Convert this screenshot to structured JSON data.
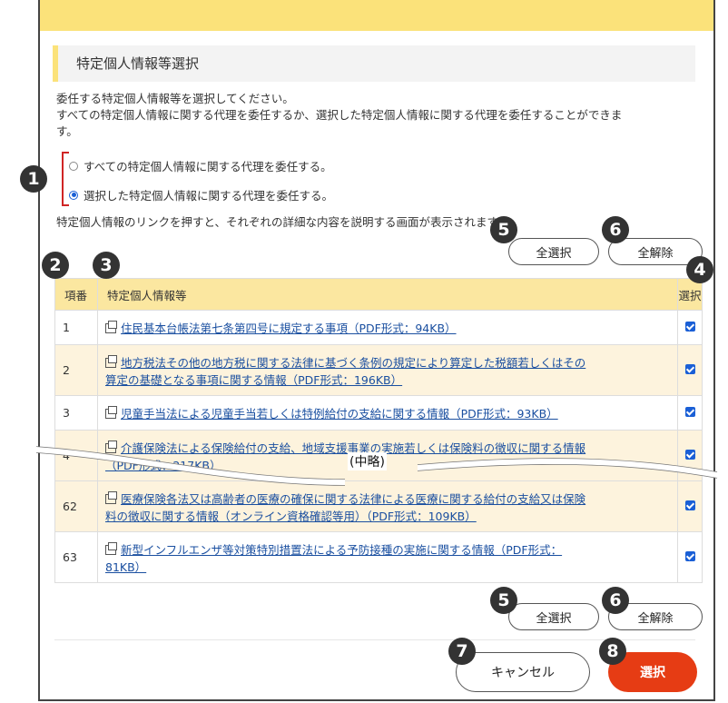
{
  "section_title": "特定個人情報等選択",
  "intro": {
    "line1": "委任する特定個人情報等を選択してください。",
    "line2": "すべての特定個人情報に関する代理を委任するか、選択した特定個人情報に関する代理を委任することができま",
    "line3": "す。"
  },
  "radios": {
    "all": "すべての特定個人情報に関する代理を委任する。",
    "selected": "選択した特定個人情報に関する代理を委任する。",
    "checked": "selected"
  },
  "note": "特定個人情報のリンクを押すと、それぞれの詳細な内容を説明する画面が表示されます。",
  "buttons": {
    "select_all": "全選択",
    "clear_all": "全解除",
    "cancel": "キャンセル",
    "confirm": "選択"
  },
  "table": {
    "headers": {
      "num": "項番",
      "info": "特定個人情報等",
      "select": "選択"
    },
    "rows": [
      {
        "num": "1",
        "line1": "住民基本台帳法第七条第四号に規定する事項（PDF形式：94KB）",
        "line2": "",
        "checked": true
      },
      {
        "num": "2",
        "line1": "地方税法その他の地方税に関する法律に基づく条例の規定により算定した税額若しくはその",
        "line2": "算定の基礎となる事項に関する情報（PDF形式：196KB）",
        "checked": true
      },
      {
        "num": "3",
        "line1": "児童手当法による児童手当若しくは特例給付の支給に関する情報（PDF形式：93KB）",
        "line2": "",
        "checked": true
      },
      {
        "num": "4",
        "line1": "介護保険法による保険給付の支給、地域支援事業の実施若しくは保険料の徴収に関する情報",
        "line2": "（PDF形式：217KB）",
        "checked": true
      },
      {
        "num": "62",
        "line1": "医療保険各法又は高齢者の医療の確保に関する法律による医療に関する給付の支給又は保険",
        "line2": "料の徴収に関する情報（オンライン資格確認等用）（PDF形式：109KB）",
        "checked": true
      },
      {
        "num": "63",
        "line1": "新型インフルエンザ等対策特別措置法による予防接種の実施に関する情報（PDF形式：",
        "line2": "81KB）",
        "checked": true
      }
    ]
  },
  "omission_label": "(中略)",
  "callouts": {
    "c1": "1",
    "c2": "2",
    "c3": "3",
    "c4": "4",
    "c5": "5",
    "c6": "6",
    "c7": "7",
    "c8": "8"
  },
  "colors": {
    "accent_yellow": "#fbe27a",
    "header_yellow": "#fbe7a0",
    "row_alt": "#fdf3dd",
    "select_red": "#e63c14",
    "link_blue": "#1a4fa0",
    "callout_red": "#d02525"
  }
}
